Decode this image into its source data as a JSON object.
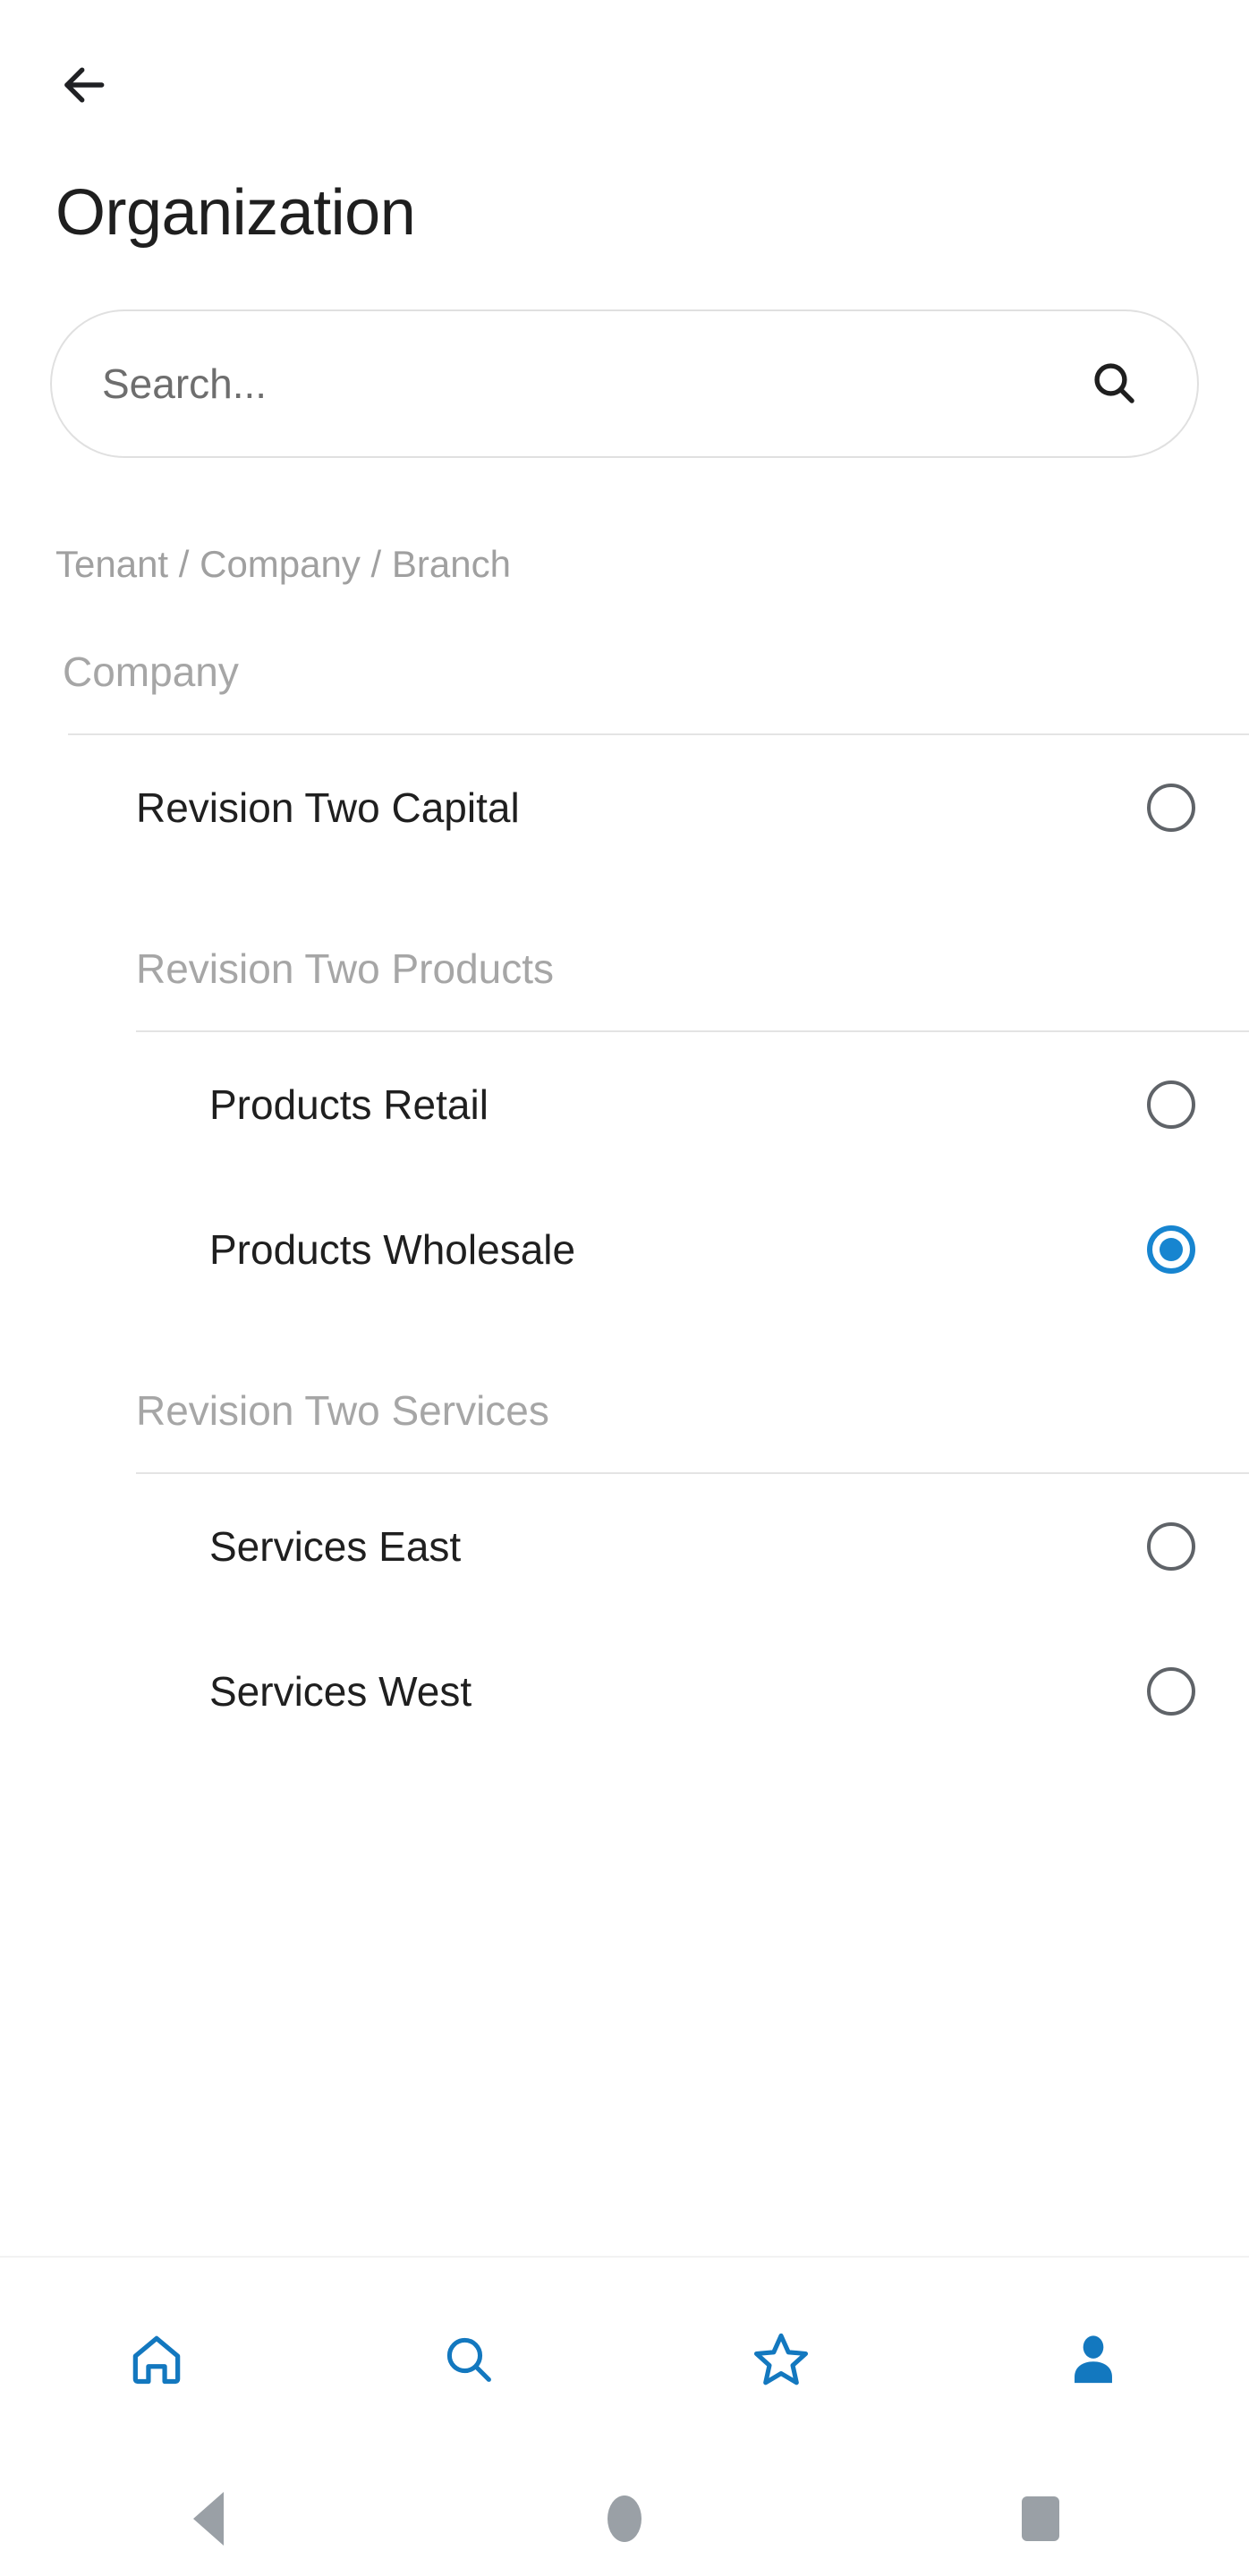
{
  "appbar": {
    "back_label": "Back",
    "back_icon": "arrow-left-icon"
  },
  "header": {
    "title": "Organization"
  },
  "search": {
    "placeholder": "Search...",
    "value": "",
    "icon": "search-icon"
  },
  "breadcrumb": {
    "text": "Tenant / Company / Branch"
  },
  "list": {
    "section_label": "Company",
    "rows": [
      {
        "kind": "option",
        "level": 0,
        "label": "Revision Two Capital",
        "selected": false
      },
      {
        "kind": "group",
        "level": 1,
        "label": "Revision Two Products"
      },
      {
        "kind": "option",
        "level": 1,
        "label": "Products Retail",
        "selected": false
      },
      {
        "kind": "option",
        "level": 1,
        "label": "Products Wholesale",
        "selected": true
      },
      {
        "kind": "group",
        "level": 1,
        "label": "Revision Two Services"
      },
      {
        "kind": "option",
        "level": 1,
        "label": "Services East",
        "selected": false
      },
      {
        "kind": "option",
        "level": 1,
        "label": "Services West",
        "selected": false
      }
    ]
  },
  "bottom_nav": {
    "active_index": 3,
    "items": [
      {
        "icon": "home-icon",
        "label": "Home",
        "active": false
      },
      {
        "icon": "search-icon",
        "label": "Search",
        "active": false
      },
      {
        "icon": "star-icon",
        "label": "Favorites",
        "active": false
      },
      {
        "icon": "person-icon",
        "label": "Profile",
        "active": true
      }
    ]
  },
  "system_bar": {
    "items": [
      {
        "icon": "triangle-back-icon",
        "label": "Back"
      },
      {
        "icon": "circle-home-icon",
        "label": "Home"
      },
      {
        "icon": "square-recents-icon",
        "label": "Recents"
      }
    ]
  },
  "colors": {
    "accent": "#1785d0",
    "text_primary": "#1f1f1f",
    "text_muted": "#a6a6a6",
    "divider": "#e4e4e4",
    "radio_outline": "#5f6368",
    "system_icon": "#9aa0a6"
  }
}
